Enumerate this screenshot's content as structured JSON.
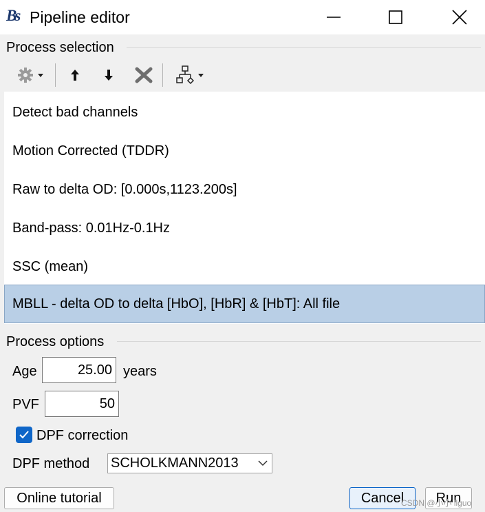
{
  "window": {
    "title": "Pipeline editor",
    "logo_text": "Bs"
  },
  "process_selection": {
    "heading": "Process selection",
    "toolbar": {
      "icons": [
        "gear-icon",
        "move-up-icon",
        "move-down-icon",
        "delete-icon",
        "pipeline-icon"
      ]
    },
    "items": [
      {
        "label": "Detect bad channels"
      },
      {
        "label": "Motion Corrected (TDDR)"
      },
      {
        "label": "Raw to delta OD: [0.000s,1123.200s]"
      },
      {
        "label": "Band-pass: 0.01Hz-0.1Hz"
      },
      {
        "label": "SSC (mean)"
      },
      {
        "label": "MBLL - delta OD to delta [HbO], [HbR] & [HbT]: All file",
        "selected": true
      }
    ]
  },
  "process_options": {
    "heading": "Process options",
    "age": {
      "label": "Age",
      "value": "25.00",
      "unit": "years"
    },
    "pvf": {
      "label": "PVF",
      "value": "50"
    },
    "dpf_correction": {
      "label": "DPF correction",
      "checked": true
    },
    "dpf_method": {
      "label": "DPF method",
      "selected": "SCHOLKMANN2013"
    }
  },
  "footer": {
    "online_tutorial_label": "Online tutorial",
    "cancel_label": "Cancel",
    "run_label": "Run"
  },
  "watermark": "CSDN @小小 llguo",
  "colors": {
    "selection": "#b9cfe6",
    "checkbox": "#0f66c8",
    "background": "#f0f0f0"
  }
}
